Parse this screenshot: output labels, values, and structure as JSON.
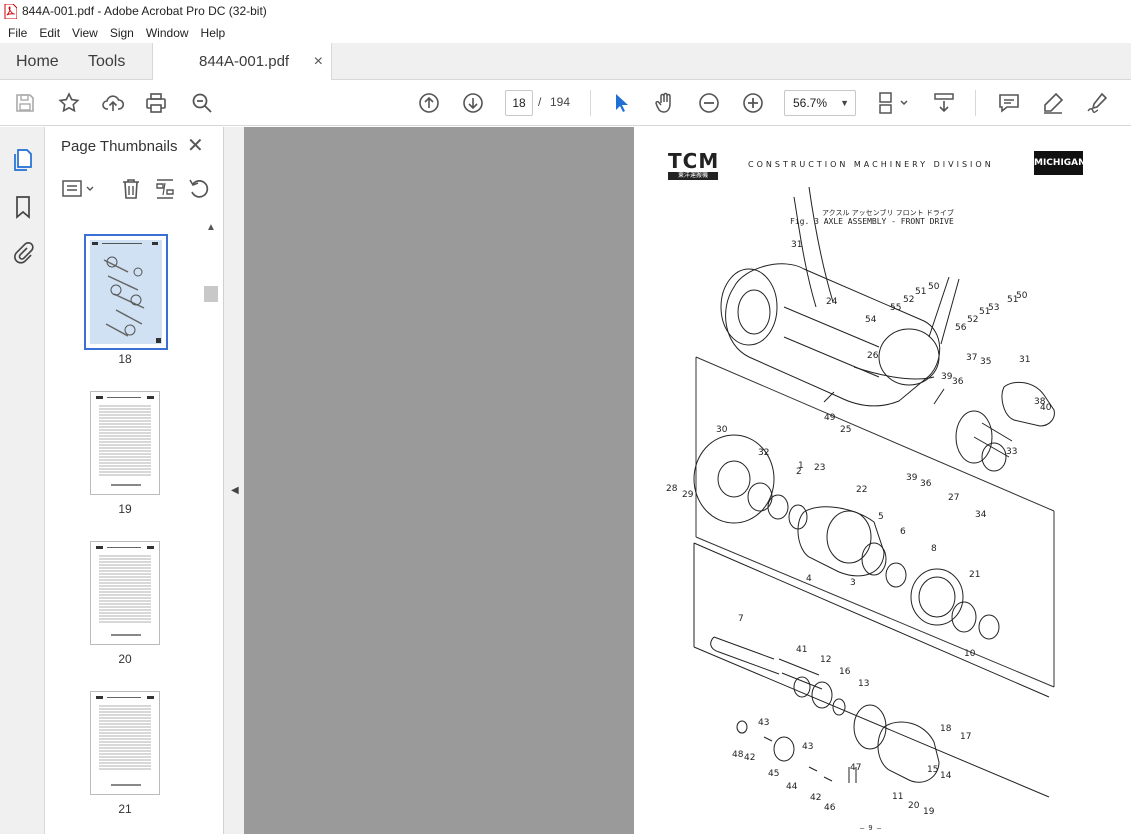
{
  "window": {
    "title": "844A-001.pdf - Adobe Acrobat Pro DC (32-bit)"
  },
  "menu": [
    "File",
    "Edit",
    "View",
    "Sign",
    "Window",
    "Help"
  ],
  "tabs": {
    "home": "Home",
    "tools": "Tools",
    "document": "844A-001.pdf",
    "close": "×"
  },
  "toolbar": {
    "current_page": "18",
    "page_separator": "/",
    "total_pages": "194",
    "zoom": "56.7%",
    "icons": [
      "save-icon",
      "bookmark-star-icon",
      "upload-cloud-icon",
      "print-icon",
      "zoom-search-icon",
      "page-up-icon",
      "page-down-icon",
      "select-cursor-icon",
      "hand-icon",
      "zoom-out-icon",
      "zoom-in-icon",
      "page-fit-icon",
      "scroll-icon",
      "comment-icon",
      "highlight-pen-icon",
      "sign-icon"
    ]
  },
  "thumbnails_panel": {
    "title": "Page Thumbnails",
    "close": "✕",
    "pages": [
      {
        "label": "18",
        "selected": true
      },
      {
        "label": "19",
        "selected": false
      },
      {
        "label": "20",
        "selected": false
      },
      {
        "label": "21",
        "selected": false
      }
    ]
  },
  "document_page": {
    "logo_left": "TCM",
    "logo_left_sub": "東洋運搬機",
    "division": "CONSTRUCTION MACHINERY DIVISION",
    "logo_right": "MICHIGAN",
    "caption_jp": "アクスル アッセンブリ  フロント ドライブ",
    "caption": "Fig. 3  AXLE ASSEMBLY - FRONT DRIVE",
    "page_footer": "— 9 —",
    "part_numbers": [
      "31",
      "24",
      "54",
      "55",
      "52",
      "51",
      "50",
      "56",
      "52",
      "51",
      "53",
      "51",
      "50",
      "37",
      "35",
      "31",
      "26",
      "39",
      "36",
      "38",
      "40",
      "49",
      "25",
      "30",
      "32",
      "1",
      "2",
      "23",
      "22",
      "33",
      "39",
      "36",
      "27",
      "28",
      "29",
      "34",
      "5",
      "6",
      "4",
      "3",
      "8",
      "21",
      "7",
      "41",
      "12",
      "16",
      "13",
      "10",
      "43",
      "42",
      "48",
      "43",
      "45",
      "44",
      "42",
      "46",
      "47",
      "18",
      "17",
      "14",
      "15",
      "11",
      "20",
      "19"
    ]
  }
}
